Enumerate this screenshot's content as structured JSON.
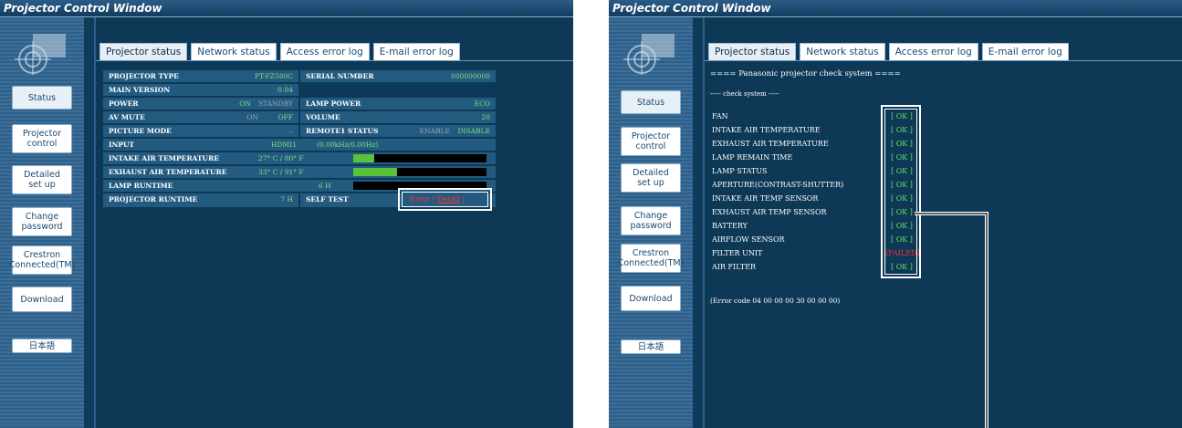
{
  "window_title": "Projector Control Window",
  "sidebar": {
    "items": [
      {
        "label": "Status"
      },
      {
        "label": "Projector\ncontrol"
      },
      {
        "label": "Detailed\nset up"
      },
      {
        "label": "Change\npassword"
      },
      {
        "label": "Crestron\nConnected(TM)"
      },
      {
        "label": "Download"
      },
      {
        "label": "日本語"
      }
    ]
  },
  "tabs": [
    "Projector status",
    "Network status",
    "Access error log",
    "E-mail error log"
  ],
  "status_table": {
    "projector_type": {
      "label": "PROJECTOR TYPE",
      "value": "PT-FZ580C"
    },
    "serial_number": {
      "label": "SERIAL NUMBER",
      "value": "000000000"
    },
    "main_version": {
      "label": "MAIN VERSION",
      "value": "0.04"
    },
    "power": {
      "label": "POWER",
      "on": "ON",
      "standby": "STANDBY"
    },
    "lamp_power": {
      "label": "LAMP POWER",
      "value": "ECO"
    },
    "av_mute": {
      "label": "AV MUTE",
      "on": "ON",
      "off": "OFF"
    },
    "volume": {
      "label": "VOLUME",
      "value": "20"
    },
    "picture_mode": {
      "label": "PICTURE MODE",
      "value": "–"
    },
    "remote1_status": {
      "label": "REMOTE1 STATUS",
      "enable": "ENABLE",
      "disable": "DISABLE"
    },
    "input": {
      "label": "INPUT",
      "value": "HDMI1",
      "freq": "(0.00kHz/0.00Hz)"
    },
    "intake_air_temperature": {
      "label": "INTAKE AIR TEMPERATURE",
      "value": "27° C / 80° F",
      "level": 0.16
    },
    "exhaust_air_temperature": {
      "label": "EXHAUST AIR TEMPERATURE",
      "value": "33° C / 91° F",
      "level": 0.33
    },
    "lamp_runtime": {
      "label": "LAMP RUNTIME",
      "value": "6 H",
      "level": 0.0
    },
    "projector_runtime": {
      "label": "PROJECTOR RUNTIME",
      "value": "7 H"
    },
    "self_test": {
      "label": "SELF TEST",
      "error": "Error",
      "detail": "Detail",
      "open": "(",
      "close": ")"
    }
  },
  "check": {
    "header": "==== Panasonic projector check system ====",
    "sub": "----- check system -----",
    "items": [
      {
        "name": "FAN",
        "result": "[ OK ]"
      },
      {
        "name": "INTAKE AIR TEMPERATURE",
        "result": "[ OK ]"
      },
      {
        "name": "EXHAUST AIR TEMPERATURE",
        "result": "[ OK ]"
      },
      {
        "name": "LAMP REMAIN TIME",
        "result": "[ OK ]"
      },
      {
        "name": "LAMP STATUS",
        "result": "[ OK ]"
      },
      {
        "name": "APERTURE(CONTRAST-SHUTTER)",
        "result": "[ OK ]"
      },
      {
        "name": "INTAKE AIR TEMP SENSOR",
        "result": "[ OK ]"
      },
      {
        "name": "EXHAUST AIR TEMP SENSOR",
        "result": "[ OK ]"
      },
      {
        "name": "BATTERY",
        "result": "[ OK ]"
      },
      {
        "name": "AIRFLOW SENSOR",
        "result": "[ OK ]"
      },
      {
        "name": "FILTER UNIT",
        "result": "[FAILED]"
      },
      {
        "name": "AIR FILTER",
        "result": "[ OK ]"
      }
    ],
    "error_code": "(Error code 04 00 00 00 30 00 00 00)"
  },
  "colors": {
    "ok": "#67e05a",
    "failed": "#ff2b2b",
    "bar_fill": "#57c23a",
    "background": "#0d3957"
  }
}
